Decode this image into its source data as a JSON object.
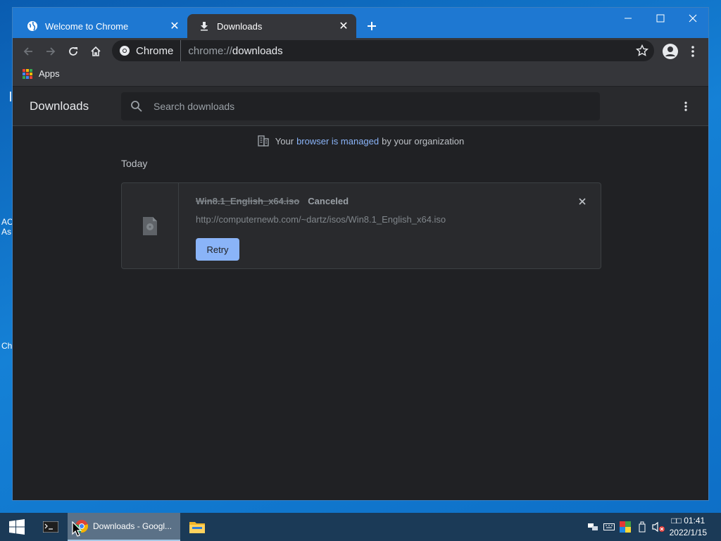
{
  "desktop": {
    "label_1": "AC",
    "label_2": "As",
    "label_3": "Ch"
  },
  "browser": {
    "tabs": [
      {
        "title": "Welcome to Chrome",
        "icon": "globe-icon",
        "active": false
      },
      {
        "title": "Downloads",
        "icon": "download-icon",
        "active": true
      }
    ],
    "omnibox": {
      "chip_label": "Chrome",
      "url_scheme": "chrome://",
      "url_host": "downloads"
    },
    "bookmarks": {
      "apps_label": "Apps"
    }
  },
  "downloads_page": {
    "title": "Downloads",
    "search_placeholder": "Search downloads",
    "managed_notice": {
      "prefix": "Your",
      "link": "browser is managed",
      "suffix": "by your organization"
    },
    "section_label": "Today",
    "items": [
      {
        "filename": "Win8.1_English_x64.iso",
        "status": "Canceled",
        "url": "http://computernewb.com/~dartz/isos/Win8.1_English_x64.iso",
        "action_label": "Retry"
      }
    ]
  },
  "taskbar": {
    "chrome_task_label": "Downloads - Googl...",
    "clock_time": "□□ 01:41",
    "clock_date": "2022/1/15"
  },
  "colors": {
    "accent": "#8ab4f8",
    "titlebar": "#1e78d2",
    "page_bg": "#202124",
    "toolbar_bg": "#35363a"
  }
}
